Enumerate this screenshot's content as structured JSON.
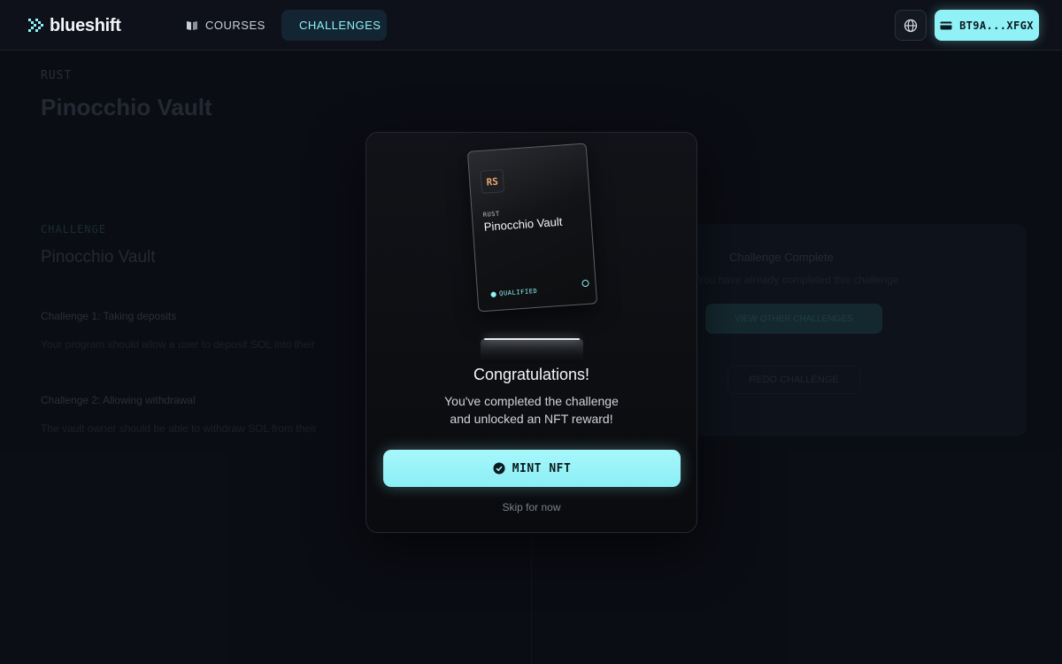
{
  "header": {
    "logo_text": "blueshift",
    "nav": {
      "courses_label": "COURSES",
      "challenges_label": "CHALLENGES"
    },
    "wallet_label": "BT9A...XFGX"
  },
  "background_page": {
    "language_tag": "RUST",
    "title": "Pinocchio Vault",
    "challenge_tag": "CHALLENGE",
    "challenge_title": "Pinocchio Vault",
    "steps": [
      {
        "heading": "Challenge 1: Taking deposits",
        "text": "Your program should allow a user to deposit SOL into their"
      },
      {
        "heading": "Challenge 2: Allowing withdrawal",
        "text": "The vault owner should be able to withdraw SOL from their"
      }
    ],
    "side_panel": {
      "title": "Challenge Complete",
      "subtitle": "You have already completed this challenge",
      "primary_button": "VIEW OTHER CHALLENGES",
      "secondary_button": "REDO CHALLENGE"
    }
  },
  "modal": {
    "nft": {
      "logo_text": "RS",
      "language": "RUST",
      "name": "Pinocchio Vault",
      "badge": "QUALIFIED"
    },
    "heading": "Congratulations!",
    "message_line1": "You've completed the challenge",
    "message_line2": "and unlocked an NFT reward!",
    "mint_label": "MINT NFT",
    "skip_label": "Skip for now"
  },
  "colors": {
    "accent": "#8ef2f6",
    "background": "#0d1018"
  },
  "icons": {
    "logo": "blueshift-chevrons-icon",
    "courses": "book-icon",
    "challenges": "sword-icon",
    "language": "globe-icon",
    "wallet": "wallet-icon",
    "mint": "check-circle-icon"
  }
}
